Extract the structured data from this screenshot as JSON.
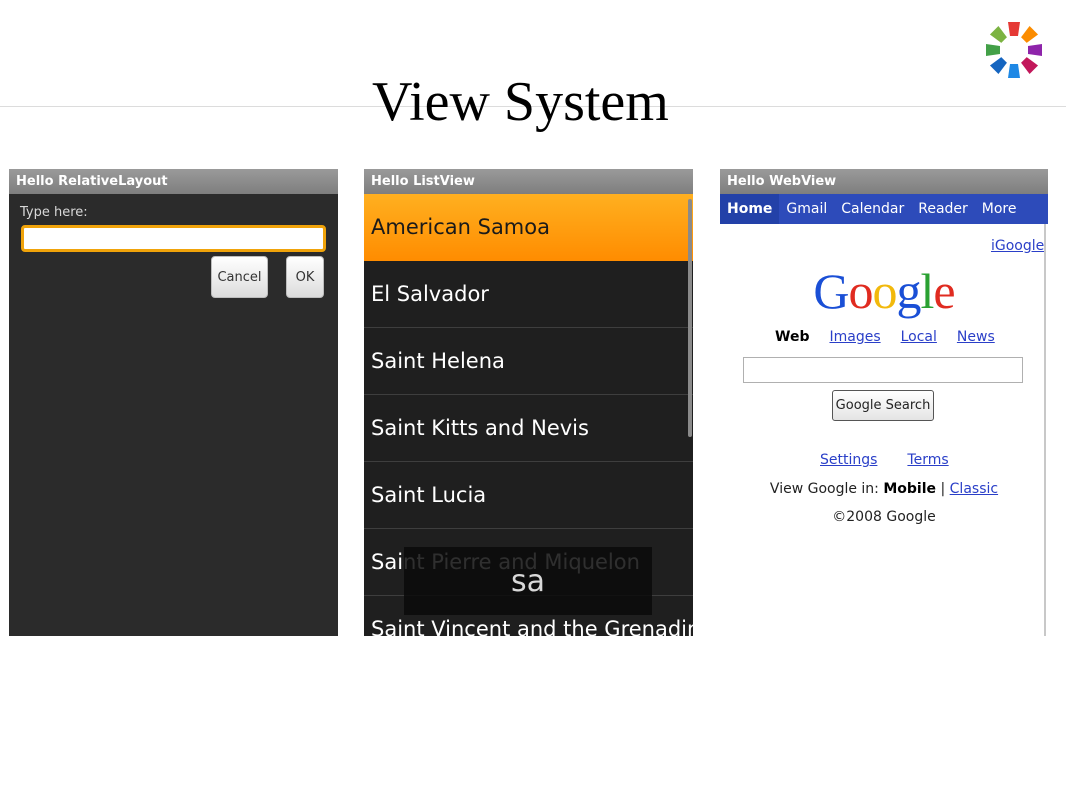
{
  "slide": {
    "title": "View System"
  },
  "colors": {
    "accent": "#ff9800",
    "google_bar": "#2d4bba",
    "dark_bg": "#2b2b2b"
  },
  "relative_layout": {
    "title": "Hello RelativeLayout",
    "label": "Type here:",
    "input_value": "",
    "cancel_label": "Cancel",
    "ok_label": "OK"
  },
  "list_view": {
    "title": "Hello ListView",
    "items": [
      {
        "label": "American Samoa",
        "selected": true
      },
      {
        "label": "El Salvador"
      },
      {
        "label": "Saint Helena"
      },
      {
        "label": "Saint Kitts and Nevis"
      },
      {
        "label": "Saint Lucia"
      },
      {
        "label": "Saint Pierre and Miquelon"
      },
      {
        "label": "Saint Vincent and the Grenadines"
      }
    ],
    "filter_text": "sa"
  },
  "web_view": {
    "title": "Hello WebView",
    "nav": [
      "Home",
      "Gmail",
      "Calendar",
      "Reader",
      "More"
    ],
    "igoogle": "iGoogle",
    "logo_text": "Google",
    "search_tabs": [
      "Web",
      "Images",
      "Local",
      "News"
    ],
    "search_button": "Google Search",
    "footer_links": [
      "Settings",
      "Terms"
    ],
    "view_in_label": "View Google in:",
    "mobile": "Mobile",
    "separator": "|",
    "classic": "Classic",
    "copyright": "©2008 Google"
  }
}
